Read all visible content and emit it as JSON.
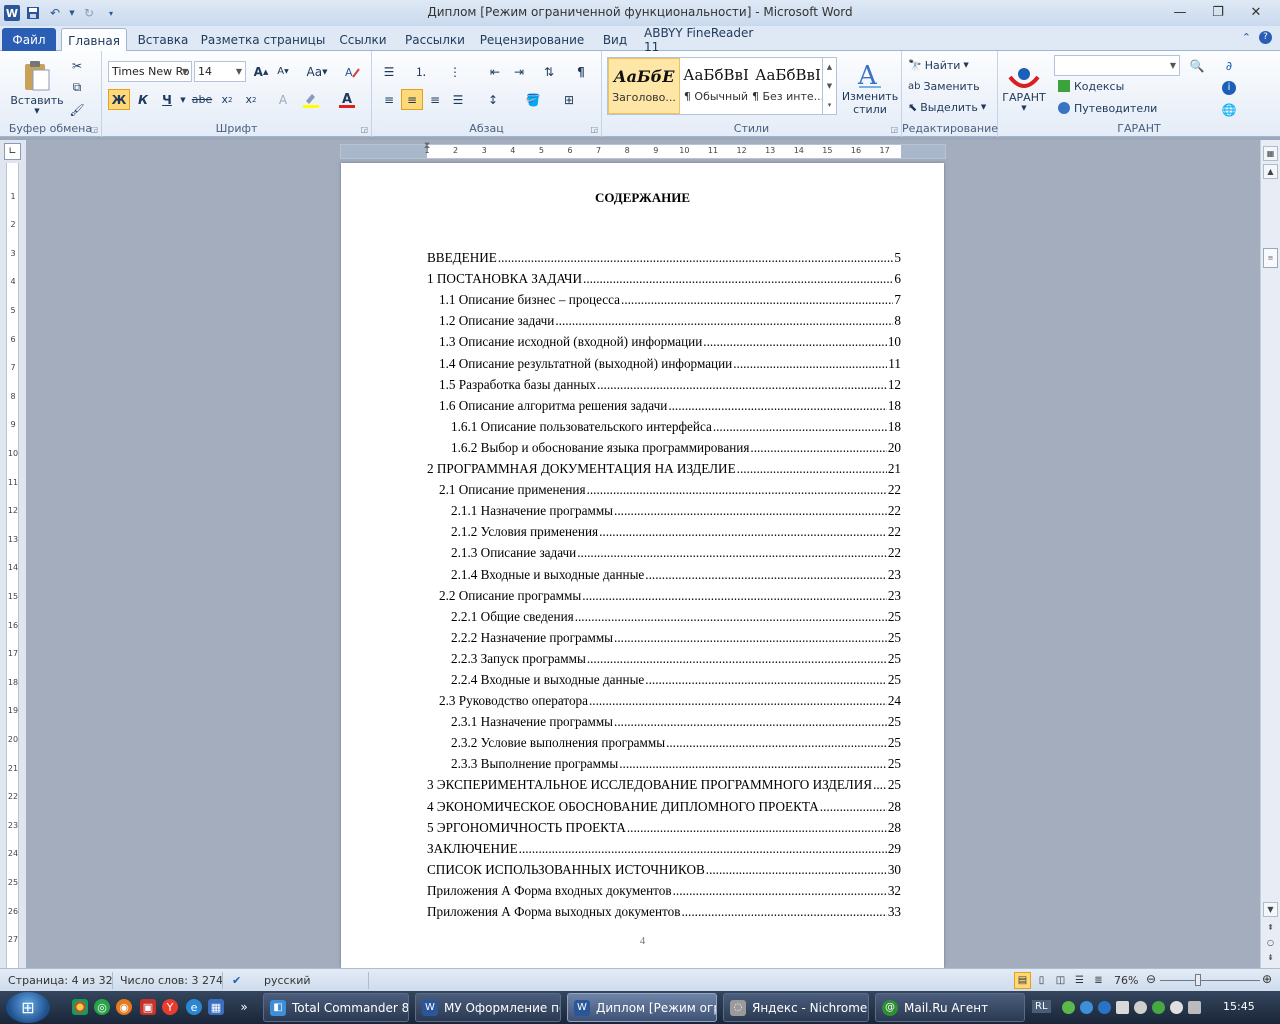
{
  "window": {
    "title": "Диплом [Режим ограниченной функциональности]  -  Microsoft Word",
    "app_icon": "word-icon"
  },
  "tabs": [
    {
      "label": "Файл"
    },
    {
      "label": "Главная"
    },
    {
      "label": "Вставка"
    },
    {
      "label": "Разметка страницы"
    },
    {
      "label": "Ссылки"
    },
    {
      "label": "Рассылки"
    },
    {
      "label": "Рецензирование"
    },
    {
      "label": "Вид"
    },
    {
      "label": "ABBYY FineReader 11"
    }
  ],
  "ribbon": {
    "clipboard": {
      "label": "Буфер обмена",
      "paste_label": "Вставить"
    },
    "font": {
      "label": "Шрифт",
      "font_name": "Times New Ro",
      "font_size": "14",
      "bold_glyph": "Ж",
      "italic_glyph": "К",
      "underline_glyph": "Ч",
      "strike_glyph": "abe",
      "case_glyph": "Аа"
    },
    "paragraph": {
      "label": "Абзац"
    },
    "styles": {
      "label": "Стили",
      "items": [
        {
          "sample": "АаБбЕ",
          "name": "Заголово..."
        },
        {
          "sample": "АаБбВвІ",
          "name": "¶ Обычный"
        },
        {
          "sample": "АаБбВвІ",
          "name": "¶ Без инте..."
        }
      ],
      "change_styles_line1": "Изменить",
      "change_styles_line2": "стили"
    },
    "editing": {
      "label": "Редактирование",
      "find": "Найти",
      "replace": "Заменить",
      "select": "Выделить"
    },
    "garant": {
      "label": "ГАРАНТ",
      "button": "ГАРАНТ",
      "codes": "Кодексы",
      "guides": "Путеводители"
    }
  },
  "document": {
    "title": "СОДЕРЖАНИЕ",
    "page_number": "4",
    "toc": [
      {
        "text": "ВВЕДЕНИЕ",
        "page": "5",
        "level": 0
      },
      {
        "text": "1 ПОСТАНОВКА ЗАДАЧИ",
        "page": "6",
        "level": 0
      },
      {
        "text": "1.1 Описание бизнес – процесса",
        "page": "7",
        "level": 1
      },
      {
        "text": "1.2 Описание задачи",
        "page": "8",
        "level": 1
      },
      {
        "text": "1.3 Описание исходной (входной) информации",
        "page": "10",
        "level": 1
      },
      {
        "text": "1.4 Описание результатной (выходной) информации",
        "page": "11",
        "level": 1
      },
      {
        "text": "1.5 Разработка базы данных",
        "page": "12",
        "level": 1
      },
      {
        "text": "1.6 Описание алгоритма решения задачи",
        "page": "18",
        "level": 1
      },
      {
        "text": "1.6.1 Описание пользовательского интерфейса",
        "page": "18",
        "level": 2
      },
      {
        "text": "1.6.2 Выбор и обоснование языка программирования",
        "page": "20",
        "level": 2
      },
      {
        "text": "2 ПРОГРАММНАЯ ДОКУМЕНТАЦИЯ НА ИЗДЕЛИЕ",
        "page": "21",
        "level": 0
      },
      {
        "text": "2.1 Описание применения",
        "page": "22",
        "level": 1
      },
      {
        "text": "2.1.1 Назначение программы",
        "page": "22",
        "level": 2
      },
      {
        "text": "2.1.2 Условия применения",
        "page": "22",
        "level": 2
      },
      {
        "text": "2.1.3 Описание задачи",
        "page": "22",
        "level": 2
      },
      {
        "text": "2.1.4 Входные и выходные данные",
        "page": "23",
        "level": 2
      },
      {
        "text": "2.2 Описание программы",
        "page": "23",
        "level": 1
      },
      {
        "text": "2.2.1 Общие сведения",
        "page": "25",
        "level": 2
      },
      {
        "text": "2.2.2 Назначение программы",
        "page": "25",
        "level": 2
      },
      {
        "text": "2.2.3 Запуск программы",
        "page": "25",
        "level": 2
      },
      {
        "text": "2.2.4 Входные и выходные данные",
        "page": "25",
        "level": 2
      },
      {
        "text": "2.3 Руководство оператора",
        "page": "24",
        "level": 1
      },
      {
        "text": "2.3.1 Назначение программы",
        "page": "25",
        "level": 2
      },
      {
        "text": "2.3.2 Условие выполнения программы",
        "page": "25",
        "level": 2
      },
      {
        "text": "2.3.3 Выполнение программы",
        "page": "25",
        "level": 2
      },
      {
        "text": "3 ЭКСПЕРИМЕНТАЛЬНОЕ ИССЛЕДОВАНИЕ ПРОГРАММНОГО ИЗДЕЛИЯ",
        "page": "25",
        "level": 0
      },
      {
        "text": "4 ЭКОНОМИЧЕСКОЕ ОБОСНОВАНИЕ ДИПЛОМНОГО ПРОЕКТА",
        "page": "28",
        "level": 0
      },
      {
        "text": "5 ЭРГОНОМИЧНОСТЬ ПРОЕКТА",
        "page": "28",
        "level": 0
      },
      {
        "text": "ЗАКЛЮЧЕНИЕ",
        "page": "29",
        "level": 0
      },
      {
        "text": "СПИСОК ИСПОЛЬЗОВАННЫХ ИСТОЧНИКОВ",
        "page": "30",
        "level": 0
      },
      {
        "text": "Приложения А Форма входных документов",
        "page": "32",
        "level": 0
      },
      {
        "text": "Приложения А Форма выходных документов",
        "page": "33",
        "level": 0
      }
    ]
  },
  "statusbar": {
    "page": "Страница: 4 из 32",
    "words": "Число слов: 3 274",
    "language": "русский",
    "zoom": "76%"
  },
  "taskbar": {
    "tasks": [
      {
        "label": "Total Commander 8...."
      },
      {
        "label": "МУ Оформление по..."
      },
      {
        "label": "Диплом [Режим огр..."
      },
      {
        "label": "Яндекс - Nichrome"
      },
      {
        "label": "Mail.Ru Агент"
      }
    ],
    "lang": "RL",
    "clock": "15:45"
  },
  "colors": {
    "accent": "#2a5eb4",
    "ribbon_bg": "#e4ecf7",
    "selected_button": "#ffd87a"
  }
}
